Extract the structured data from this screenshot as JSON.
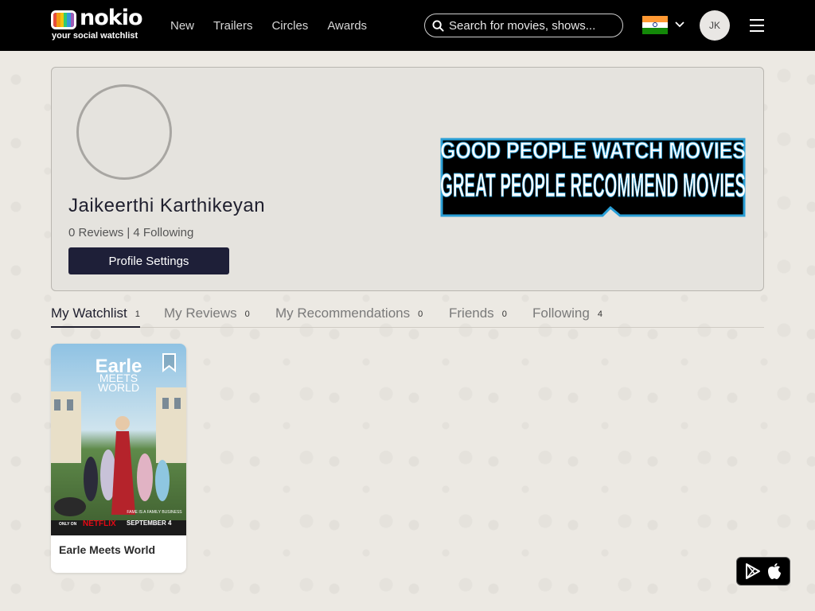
{
  "header": {
    "logo_word": "nokio",
    "logo_tagline": "your social watchlist",
    "nav": [
      {
        "label": "New"
      },
      {
        "label": "Trailers"
      },
      {
        "label": "Circles"
      },
      {
        "label": "Awards"
      }
    ],
    "search_placeholder": "Search for movies, shows...",
    "avatar_initials": "JK",
    "flag_colors": [
      "#ff9933",
      "#ffffff",
      "#138808"
    ]
  },
  "profile": {
    "name": "Jaikeerthi Karthikeyan",
    "stats": "0 Reviews | 4 Following",
    "settings_label": "Profile Settings",
    "banner_line1": "GOOD PEOPLE WATCH MOVIES",
    "banner_line2": "GREAT PEOPLE RECOMMEND MOVIES"
  },
  "tabs": [
    {
      "label": "My Watchlist",
      "count": "1",
      "active": true
    },
    {
      "label": "My Reviews",
      "count": "0"
    },
    {
      "label": "My Recommendations",
      "count": "0"
    },
    {
      "label": "Friends",
      "count": "0"
    },
    {
      "label": "Following",
      "count": "4"
    }
  ],
  "watchlist": [
    {
      "title": "Earle Meets World",
      "poster_title_1": "Earle",
      "poster_title_2": "MEETS",
      "poster_title_3": "WORLD",
      "poster_tagline": "FAME IS A FAMILY BUSINESS",
      "poster_only_on": "ONLY ON",
      "poster_network": "NETFLIX",
      "poster_date": "SEPTEMBER 4"
    }
  ],
  "colors": {
    "accent": "#1e1f38",
    "page_bg": "#ece9e3",
    "card_bg": "#e5e3de"
  }
}
